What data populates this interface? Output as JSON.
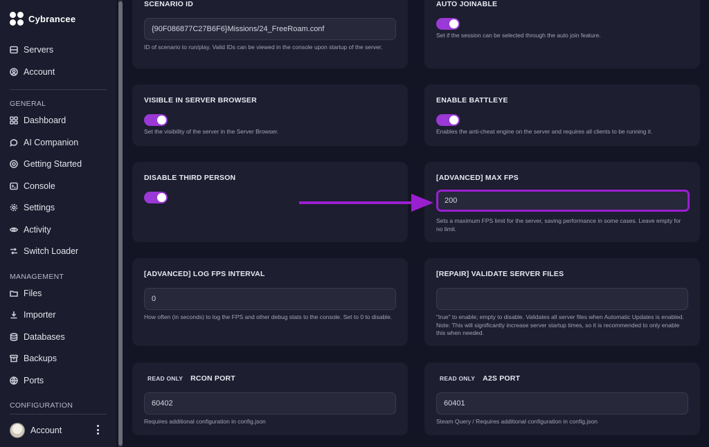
{
  "brand": {
    "name": "Cybrancee"
  },
  "nav_top": [
    {
      "label": "Servers",
      "icon": "server-icon"
    },
    {
      "label": "Account",
      "icon": "user-circle-icon"
    }
  ],
  "sections": {
    "general": "GENERAL",
    "management": "MANAGEMENT",
    "configuration": "CONFIGURATION"
  },
  "nav_general": [
    {
      "label": "Dashboard",
      "icon": "grid-icon"
    },
    {
      "label": "AI Companion",
      "icon": "chat-icon"
    },
    {
      "label": "Getting Started",
      "icon": "lifebuoy-icon"
    },
    {
      "label": "Console",
      "icon": "terminal-icon"
    },
    {
      "label": "Settings",
      "icon": "gear-icon"
    },
    {
      "label": "Activity",
      "icon": "eye-icon"
    },
    {
      "label": "Switch Loader",
      "icon": "shuffle-icon"
    }
  ],
  "nav_management": [
    {
      "label": "Files",
      "icon": "folder-icon"
    },
    {
      "label": "Importer",
      "icon": "download-icon"
    },
    {
      "label": "Databases",
      "icon": "database-icon"
    },
    {
      "label": "Backups",
      "icon": "archive-icon"
    },
    {
      "label": "Ports",
      "icon": "globe-icon"
    }
  ],
  "account": {
    "name": "Account"
  },
  "cards": {
    "scenario": {
      "title": "SCENARIO ID",
      "value": "{90F086877C27B6F6}Missions/24_FreeRoam.conf",
      "desc": "ID of scenario to run/play. Valid IDs can be viewed in the console upon startup of the server."
    },
    "auto_joinable": {
      "title": "AUTO JOINABLE",
      "enabled": true,
      "desc": "Set if the session can be selected through the auto join feature."
    },
    "visible_browser": {
      "title": "VISIBLE IN SERVER BROWSER",
      "enabled": true,
      "desc": "Set the visibility of the server in the Server Browser."
    },
    "battleye": {
      "title": "ENABLE BATTLEYE",
      "enabled": true,
      "desc": "Enables the anti-cheat engine on the server and requires all clients to be running it."
    },
    "third_person": {
      "title": "DISABLE THIRD PERSON",
      "enabled": true
    },
    "max_fps": {
      "title": "[ADVANCED] MAX FPS",
      "value": "200",
      "desc": "Sets a maximum FPS limit for the server, saving performance in some cases. Leave empty for no limit."
    },
    "log_fps": {
      "title": "[ADVANCED] LOG FPS INTERVAL",
      "value": "0",
      "desc": "How often (in seconds) to log the FPS and other debug stats to the console. Set to 0 to disable."
    },
    "validate": {
      "title": "[REPAIR] VALIDATE SERVER FILES",
      "value": "",
      "desc": "\"true\" to enable; empty to disable. Validates all server files when Automatic Updates is enabled. Note: This will significantly increase server startup times, so it is recommended to only enable this when needed."
    },
    "rcon": {
      "badge": "READ ONLY",
      "title": "RCON PORT",
      "value": "60402",
      "desc": "Requires additional configuration in config.json"
    },
    "a2s": {
      "badge": "READ ONLY",
      "title": "A2S PORT",
      "value": "60401",
      "desc": "Steam Query / Requires additional configuration in config.json"
    }
  },
  "colors": {
    "accent": "#9b39d6",
    "highlight": "#9a1fd0",
    "card": "#1d1e30",
    "background": "#141524"
  }
}
